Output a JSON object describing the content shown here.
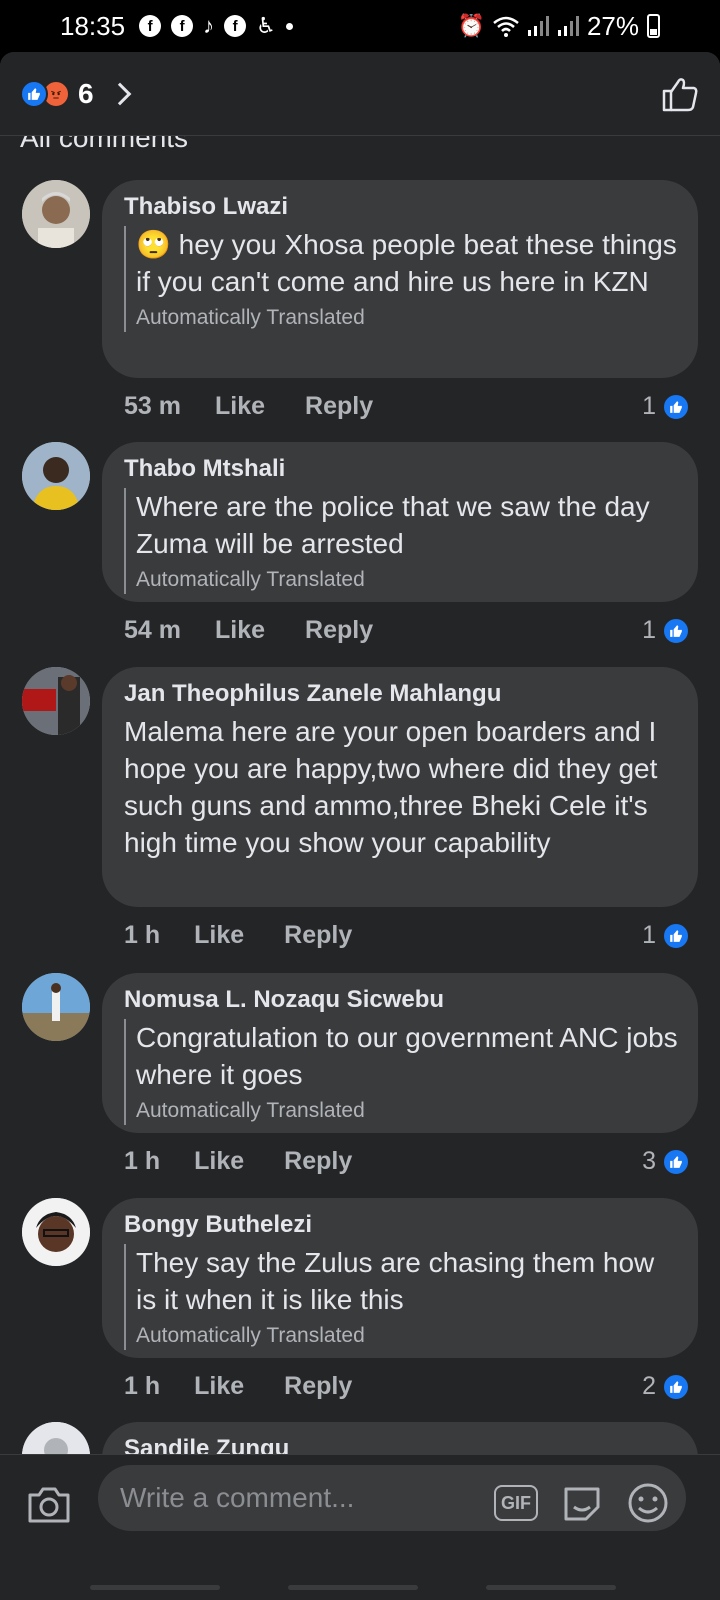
{
  "status_bar": {
    "time": "18:35",
    "battery": "27%",
    "notification_icons": [
      "facebook-icon",
      "facebook-icon",
      "tiktok-icon",
      "facebook-icon",
      "accessibility-icon"
    ]
  },
  "header": {
    "reaction_count": "6",
    "section_title": "All comments"
  },
  "comments": [
    {
      "author": "Thabiso Lwazi",
      "emoji": "🙄",
      "text": "hey you Xhosa people beat these things if you can't come and hire us here in KZN",
      "tag": "Automatically Translated",
      "time": "53 m",
      "like_label": "Like",
      "reply_label": "Reply",
      "reactions": "1"
    },
    {
      "author": "Thabo Mtshali",
      "text": "Where are the police that we saw the day Zuma will be arrested",
      "tag": "Automatically Translated",
      "time": "54 m",
      "like_label": "Like",
      "reply_label": "Reply",
      "reactions": "1"
    },
    {
      "author": "Jan Theophilus Zanele Mahlangu",
      "text": "Malema here are your open boarders and I hope you are happy,two where did they get such guns and ammo,three Bheki Cele it's high time you show your capability",
      "time": "1 h",
      "like_label": "Like",
      "reply_label": "Reply",
      "reactions": "1"
    },
    {
      "author": "Nomusa L. Nozaqu Sicwebu",
      "text": "Congratulation to our government ANC jobs where it goes",
      "tag": "Automatically Translated",
      "time": "1 h",
      "like_label": "Like",
      "reply_label": "Reply",
      "reactions": "3"
    },
    {
      "author": "Bongy Buthelezi",
      "text": "They say the Zulus are chasing them how is it when it is like this",
      "tag": "Automatically Translated",
      "time": "1 h",
      "like_label": "Like",
      "reply_label": "Reply",
      "reactions": "2"
    },
    {
      "author": "Sandile Zungu"
    }
  ],
  "composer": {
    "placeholder": "Write a comment...",
    "gif_label": "GIF"
  },
  "colors": {
    "background": "#242526",
    "bubble": "#3a3b3c",
    "like_blue": "#1877f2",
    "angry_orange": "#f0633a",
    "text_primary": "#e4e6eb",
    "text_secondary": "#b0b3b8"
  }
}
